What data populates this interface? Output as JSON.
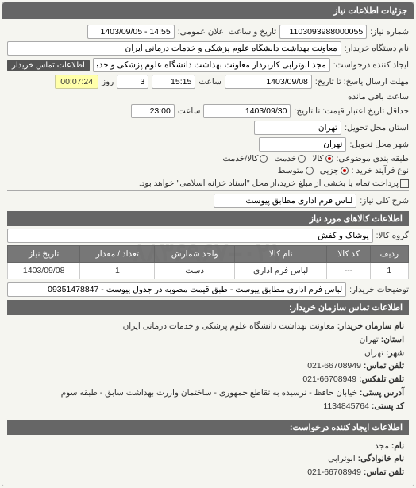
{
  "watermark": "۰۲۱–۸۸۳۶۹۶۷",
  "header": {
    "title": "جزئیات اطلاعات نیاز"
  },
  "form": {
    "reqNoLabel": "شماره نیاز:",
    "reqNo": "1103093988000055",
    "announceLabel": "تاریخ و ساعت اعلان عمومی:",
    "announce": "14:55 - 1403/09/05",
    "deviceLabel": "نام دستگاه خریدار:",
    "device": "معاونت بهداشت دانشگاه علوم پزشکی و خدمات درمانی ایران",
    "creatorLabel": "ایجاد کننده درخواست:",
    "creator": "مجد ابوترابی کاربردار معاونت بهداشت دانشگاه علوم پزشکی و خدمات درمانی ا",
    "buyerContactLink": "اطلاعات تماس خریدار",
    "answerDeadlineLabel": "مهلت ارسال پاسخ: تا تاریخ:",
    "answerDate": "1403/09/08",
    "timeLabel": "ساعت",
    "answerTime": "15:15",
    "daysRemain": "3",
    "daysRemainLabel": "روز",
    "countdown": "00:07:24",
    "remainLabel": "ساعت باقی مانده",
    "priceDeadlineLabel": "حداقل تاریخ اعتبار قیمت: تا تاریخ:",
    "priceDate": "1403/09/30",
    "priceTime": "23:00",
    "provinceLabel": "استان محل تحویل:",
    "province": "تهران",
    "cityLabel": "شهر محل تحویل:",
    "city": "تهران",
    "categoryLabel": "طبقه بندی موضوعی:",
    "catOptions": {
      "kala": "کالا",
      "khadamat": "خدمت",
      "kalaKhadamat": "کالا/خدمت"
    },
    "buyTypeLabel": "نوع فرآیند خرید :",
    "buyOptions": {
      "jozi": "جزیی",
      "motavaset": "متوسط"
    },
    "payNote": "پرداخت تمام یا بخشی از مبلغ خرید،از محل \"اسناد خزانه اسلامی\" خواهد بود.",
    "summaryLabel": "شرح کلی نیاز:",
    "summary": "لباس فرم اداری مطابق پیوست"
  },
  "itemsTitle": "اطلاعات کالاهای مورد نیاز",
  "groupLabel": "گروه کالا:",
  "group": "پوشاک و کفش",
  "table": {
    "headers": [
      "ردیف",
      "کد کالا",
      "نام کالا",
      "واحد شمارش",
      "تعداد / مقدار",
      "تاریخ نیاز"
    ],
    "row": [
      "1",
      "---",
      "لباس فرم اداری",
      "دست",
      "1",
      "1403/09/08"
    ]
  },
  "buyerNotesLabel": "توضیحات خریدار:",
  "buyerNotes": "لباس فرم اداری مطابق پیوست - طبق قیمت مصوبه در جدول پیوست - 09351478847",
  "contactTitle": "اطلاعات تماس سازمان خریدار:",
  "contact": {
    "orgNameLabel": "نام سازمان خریدار:",
    "orgName": "معاونت بهداشت دانشگاه علوم پزشکی و خدمات درمانی ایران",
    "provinceLabel": "استان:",
    "province": "تهران",
    "cityLabel": "شهر:",
    "city": "تهران",
    "phoneLabel": "تلفن تماس:",
    "phone": "66708949-021",
    "faxLabel": "تلفن تلفکس:",
    "fax": "66708949-021",
    "addressLabel": "آدرس پستی:",
    "address": "خیابان حافظ - نرسیده به تقاطع جمهوری - ساختمان وازرت بهداشت سابق - طبقه سوم",
    "postalLabel": "کد پستی:",
    "postal": "1134845764"
  },
  "creatorContactTitle": "اطلاعات ایجاد کننده درخواست:",
  "creatorContact": {
    "nameLabel": "نام:",
    "name": "مجد",
    "familyLabel": "نام خانوادگی:",
    "family": "ابوترابی",
    "phoneLabel": "تلفن تماس:",
    "phone": "66708949-021"
  }
}
